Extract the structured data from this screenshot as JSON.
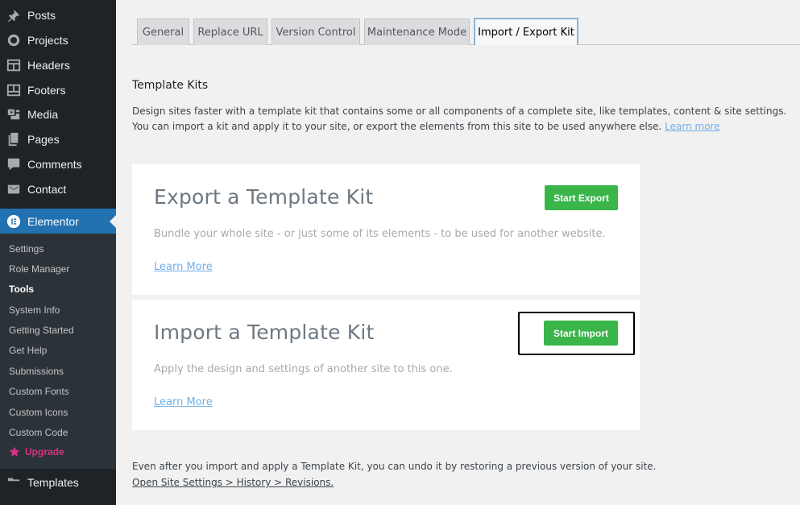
{
  "sidebar": {
    "items": [
      {
        "label": "Posts",
        "icon": "pin-icon"
      },
      {
        "label": "Projects",
        "icon": "circle-icon"
      },
      {
        "label": "Headers",
        "icon": "header-layout-icon"
      },
      {
        "label": "Footers",
        "icon": "footer-layout-icon"
      },
      {
        "label": "Media",
        "icon": "media-icon"
      },
      {
        "label": "Pages",
        "icon": "pages-icon"
      },
      {
        "label": "Comments",
        "icon": "comment-icon"
      },
      {
        "label": "Contact",
        "icon": "mail-icon"
      },
      {
        "label": "Elementor",
        "icon": "elementor-icon"
      }
    ],
    "submenu": [
      "Settings",
      "Role Manager",
      "Tools",
      "System Info",
      "Getting Started",
      "Get Help",
      "Submissions",
      "Custom Fonts",
      "Custom Icons",
      "Custom Code"
    ],
    "current_sub": "Tools",
    "upgrade_label": "Upgrade",
    "templates_label": "Templates"
  },
  "tabs": [
    {
      "label": "General"
    },
    {
      "label": "Replace URL"
    },
    {
      "label": "Version Control"
    },
    {
      "label": "Maintenance Mode"
    },
    {
      "label": "Import / Export Kit"
    }
  ],
  "main": {
    "title": "Template Kits",
    "desc_line1": "Design sites faster with a template kit that contains some or all components of a complete site, like templates, content & site settings.",
    "desc_line2": "You can import a kit and apply it to your site, or export the elements from this site to be used anywhere else.",
    "learn_more_inline": "Learn more",
    "export_card": {
      "title": "Export a Template Kit",
      "desc": "Bundle your whole site - or just some of its elements - to be used for another website.",
      "link": "Learn More",
      "button": "Start Export"
    },
    "import_card": {
      "title": "Import a Template Kit",
      "desc": "Apply the design and settings of another site to this one.",
      "link": "Learn More",
      "button": "Start Import"
    },
    "footer_line1": "Even after you import and apply a Template Kit, you can undo it by restoring a previous version of your site.",
    "footer_link": "Open Site Settings > History > Revisions."
  },
  "colors": {
    "sidebar_bg": "#1d2327",
    "submenu_bg": "#2c3338",
    "active_blue": "#2271b1",
    "button_green": "#39b54a",
    "link_blue": "#72aee6",
    "upgrade_pink": "#d63384"
  }
}
